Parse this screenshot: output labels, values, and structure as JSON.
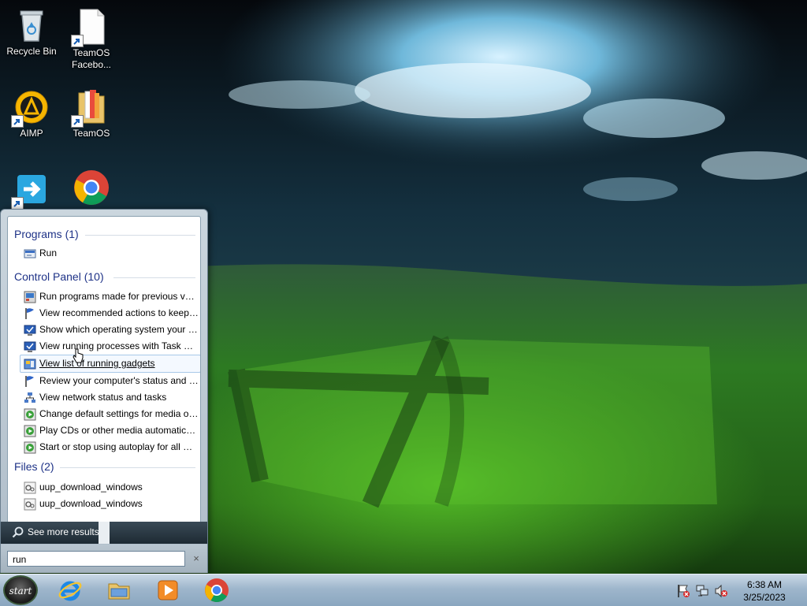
{
  "desktop": {
    "icons": [
      {
        "label": "Recycle Bin",
        "icon": "recycle-bin-icon"
      },
      {
        "label": "TeamOS Facebo...",
        "icon": "document-icon"
      },
      {
        "label": "AIMP",
        "icon": "aimp-icon"
      },
      {
        "label": "TeamOS",
        "icon": "folder-icon"
      },
      {
        "label": "",
        "icon": "app-arrow-icon"
      },
      {
        "label": "",
        "icon": "chrome-icon"
      }
    ]
  },
  "start_menu": {
    "groups": [
      {
        "header": "Programs (1)",
        "items": [
          {
            "label": "Run",
            "icon": "run-icon"
          }
        ]
      },
      {
        "header": "Control Panel (10)",
        "items": [
          {
            "label": "Run programs made for previous versions of Windows",
            "icon": "compat-icon"
          },
          {
            "label": "View recommended actions to keep Windows running smoothly",
            "icon": "flag-icon"
          },
          {
            "label": "Show which operating system your computer is running",
            "icon": "system-icon"
          },
          {
            "label": "View running processes with Task Manager",
            "icon": "system-icon"
          },
          {
            "label": "View list of running gadgets",
            "icon": "gadget-icon"
          },
          {
            "label": "Review your computer's status and resolve issues",
            "icon": "flag-icon"
          },
          {
            "label": "View network status and tasks",
            "icon": "network-icon"
          },
          {
            "label": "Change default settings for media or devices",
            "icon": "autoplay-icon"
          },
          {
            "label": "Play CDs or other media automatically",
            "icon": "autoplay-icon"
          },
          {
            "label": "Start or stop using autoplay for all media and devices",
            "icon": "autoplay-icon"
          }
        ]
      },
      {
        "header": "Files (2)",
        "items": [
          {
            "label": "uup_download_windows",
            "icon": "script-file-icon"
          },
          {
            "label": "uup_download_windows",
            "icon": "script-file-icon"
          }
        ]
      }
    ],
    "see_more": "See more results",
    "search_value": "run",
    "clear_glyph": "×"
  },
  "taskbar": {
    "start_label": "start",
    "pinned": [
      "internet-explorer-icon",
      "explorer-folder-icon",
      "media-player-icon",
      "chrome-icon"
    ],
    "tray": [
      "action-center-flag-icon",
      "network-icon",
      "volume-muted-icon"
    ],
    "clock_time": "6:38 AM",
    "clock_date": "3/25/2023"
  }
}
